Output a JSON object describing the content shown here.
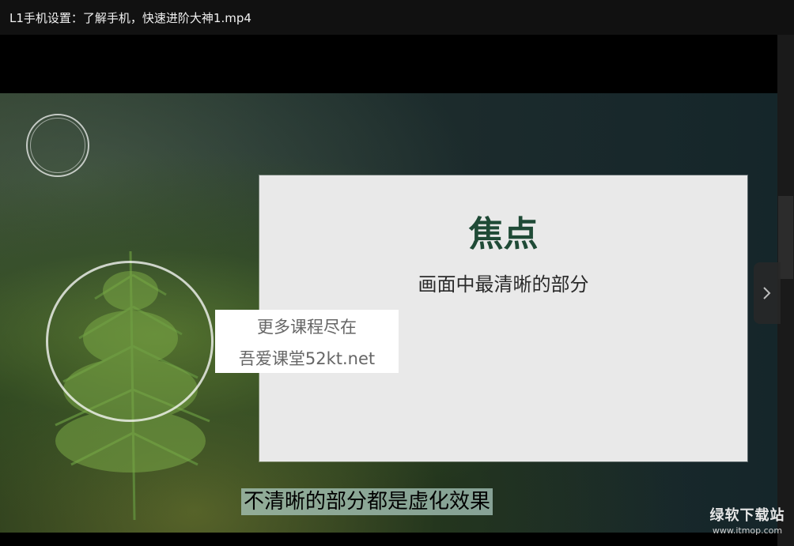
{
  "window": {
    "title": "L1手机设置：了解手机，快速进阶大神1.mp4"
  },
  "slide": {
    "heading": "焦点",
    "subheading": "画面中最清晰的部分"
  },
  "watermark": {
    "line1": "更多课程尽在",
    "line2": "吾爱课堂52kt.net"
  },
  "caption": "不清晰的部分都是虚化效果",
  "brand": {
    "name": "绿软下载站",
    "url": "www.itmop.com"
  },
  "icons": {
    "next": "chevron-right-icon",
    "logo": "calligraphy-logo-icon"
  }
}
